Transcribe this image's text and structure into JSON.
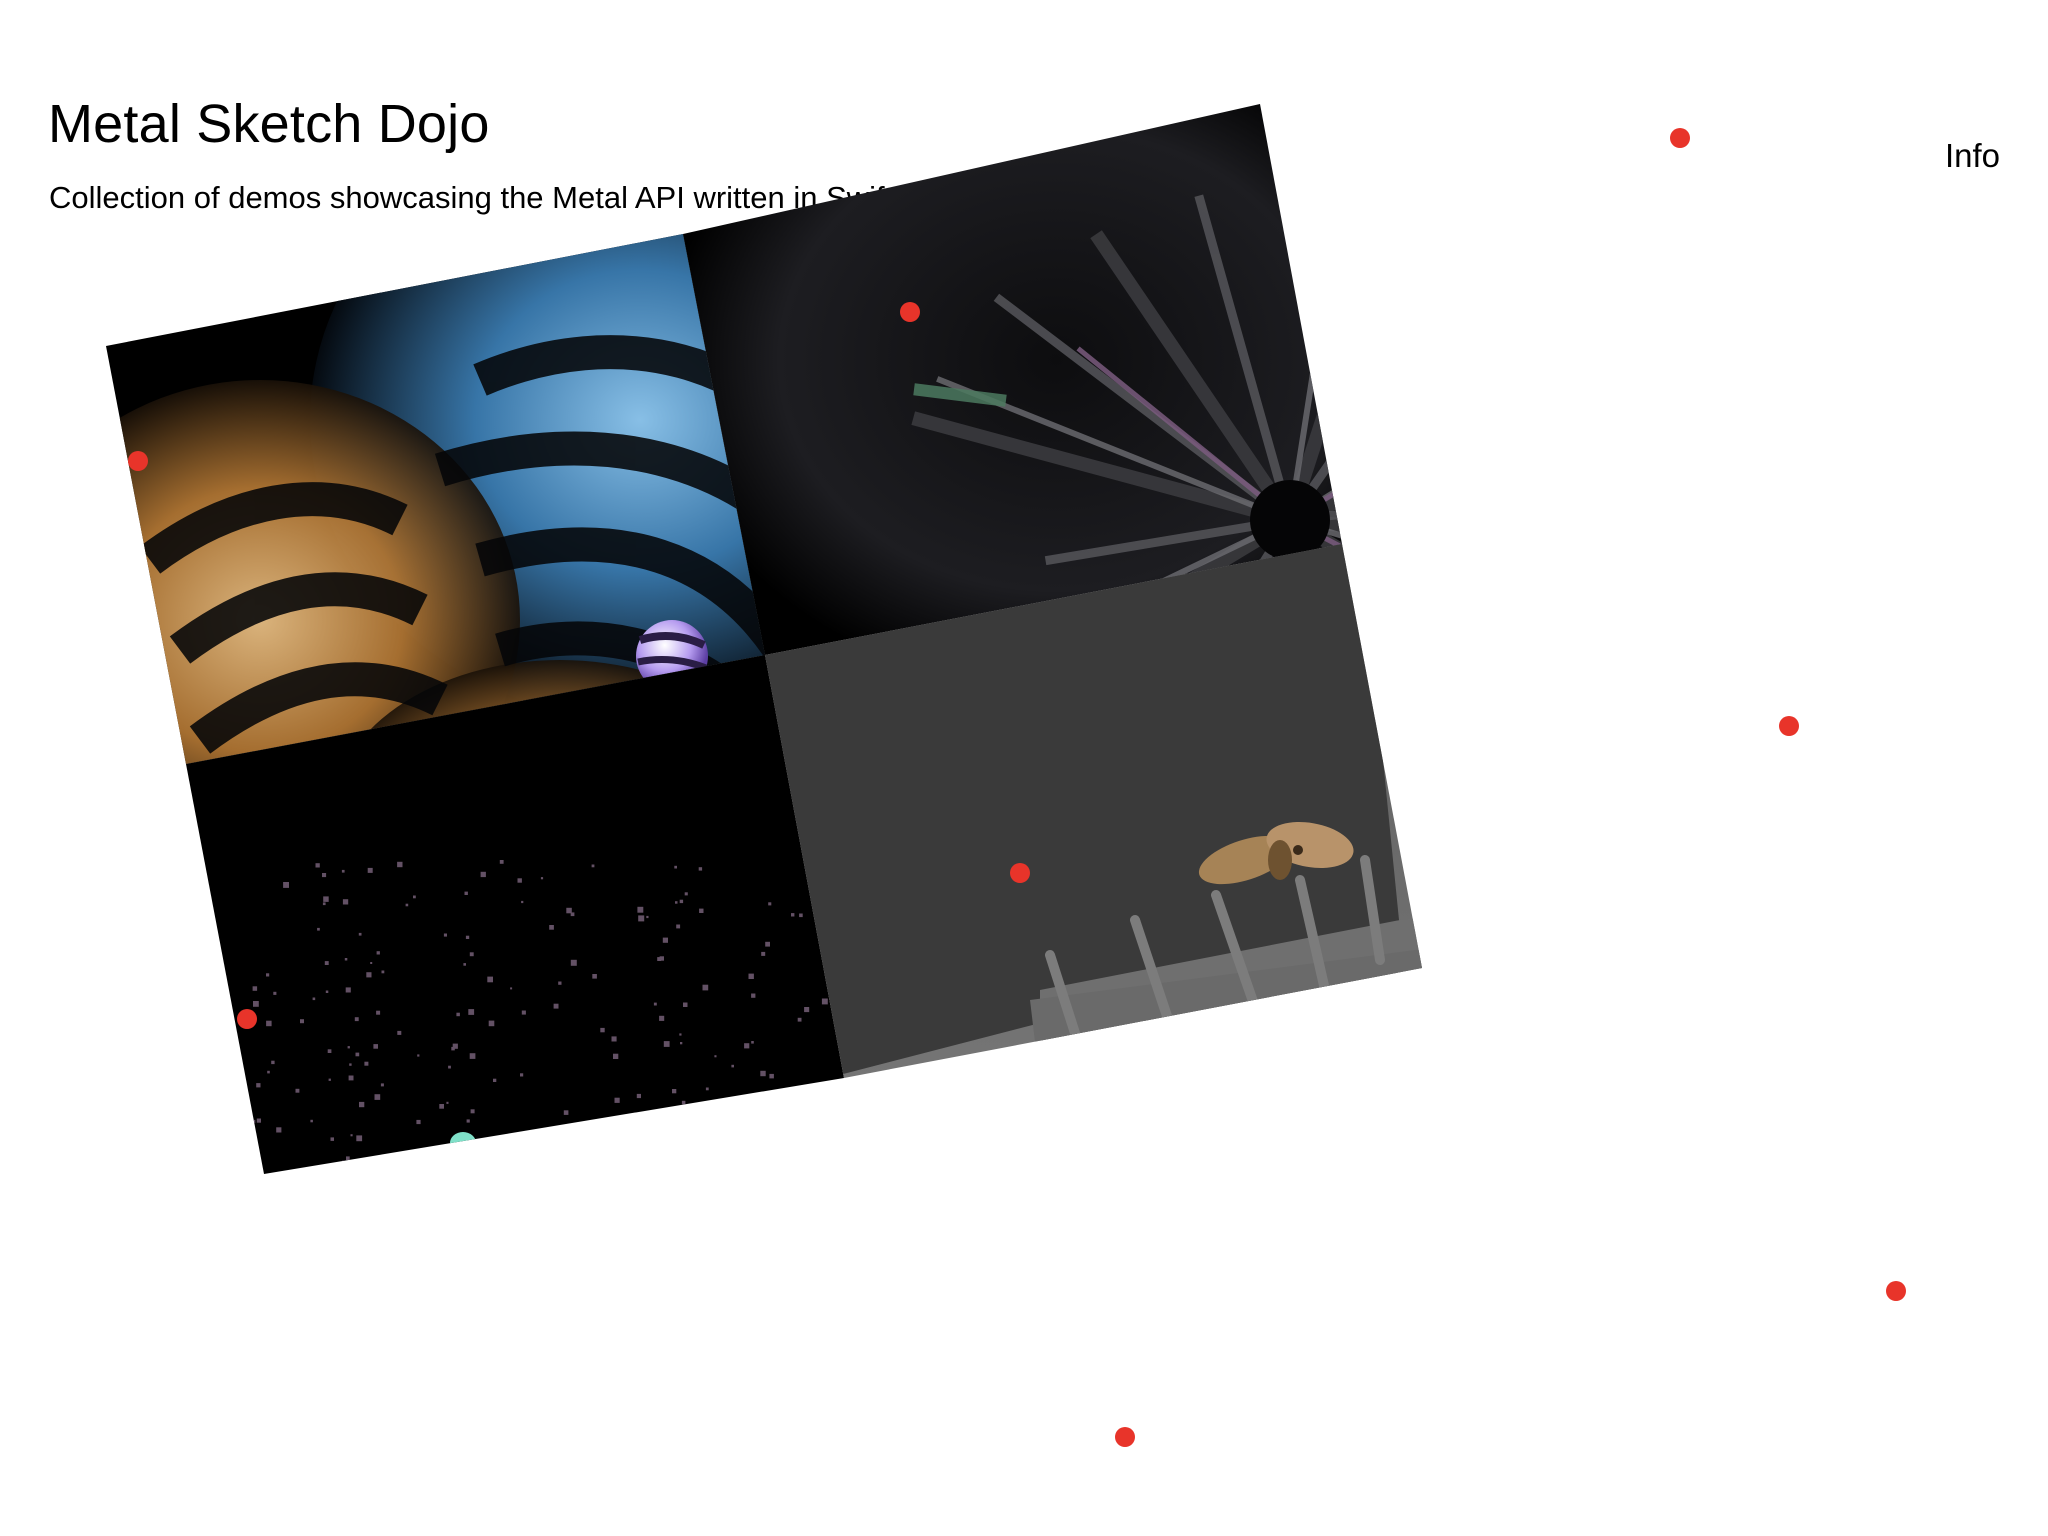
{
  "app": {
    "title": "Metal Sketch Dojo",
    "subtitle": "Collection of demos showcasing the Metal API written in Swift and C++",
    "info_label": "Info"
  },
  "demos": [
    {
      "name": "spheres-stripes-demo",
      "interactable": true
    },
    {
      "name": "box-tunnel-demo",
      "interactable": true
    },
    {
      "name": "particle-space-demo",
      "interactable": true
    },
    {
      "name": "dinosaur-shadow-demo",
      "interactable": true
    }
  ],
  "colors": {
    "accent_handle": "#E8342A",
    "background": "#FFFFFF",
    "text": "#000000"
  }
}
